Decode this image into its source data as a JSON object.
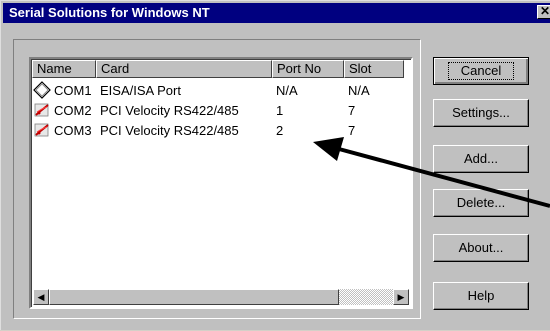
{
  "window": {
    "title": "Serial Solutions for Windows NT",
    "close_glyph": "✕"
  },
  "list": {
    "columns": [
      "Name",
      "Card",
      "Port No",
      "Slot"
    ],
    "rows": [
      {
        "icon": "diamond-port-icon",
        "name": "COM1",
        "card": "EISA/ISA Port",
        "port": "N/A",
        "slot": "N/A"
      },
      {
        "icon": "pci-card-icon",
        "name": "COM2",
        "card": "PCI Velocity RS422/485",
        "port": "1",
        "slot": "7"
      },
      {
        "icon": "pci-card-icon",
        "name": "COM3",
        "card": "PCI Velocity RS422/485",
        "port": "2",
        "slot": "7"
      }
    ]
  },
  "buttons": {
    "cancel": "Cancel",
    "settings": "Settings...",
    "add": "Add...",
    "delete": "Delete...",
    "about": "About...",
    "help": "Help"
  },
  "scrollbar": {
    "left_glyph": "◀",
    "right_glyph": "▶"
  }
}
